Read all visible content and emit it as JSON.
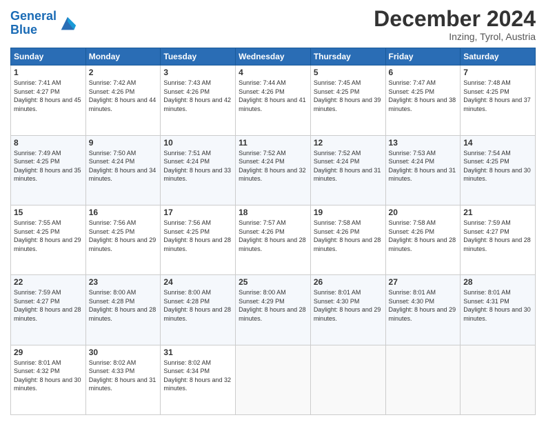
{
  "header": {
    "logo_line1": "General",
    "logo_line2": "Blue",
    "title": "December 2024",
    "subtitle": "Inzing, Tyrol, Austria"
  },
  "weekdays": [
    "Sunday",
    "Monday",
    "Tuesday",
    "Wednesday",
    "Thursday",
    "Friday",
    "Saturday"
  ],
  "weeks": [
    [
      {
        "day": "1",
        "sunrise": "Sunrise: 7:41 AM",
        "sunset": "Sunset: 4:27 PM",
        "daylight": "Daylight: 8 hours and 45 minutes."
      },
      {
        "day": "2",
        "sunrise": "Sunrise: 7:42 AM",
        "sunset": "Sunset: 4:26 PM",
        "daylight": "Daylight: 8 hours and 44 minutes."
      },
      {
        "day": "3",
        "sunrise": "Sunrise: 7:43 AM",
        "sunset": "Sunset: 4:26 PM",
        "daylight": "Daylight: 8 hours and 42 minutes."
      },
      {
        "day": "4",
        "sunrise": "Sunrise: 7:44 AM",
        "sunset": "Sunset: 4:26 PM",
        "daylight": "Daylight: 8 hours and 41 minutes."
      },
      {
        "day": "5",
        "sunrise": "Sunrise: 7:45 AM",
        "sunset": "Sunset: 4:25 PM",
        "daylight": "Daylight: 8 hours and 39 minutes."
      },
      {
        "day": "6",
        "sunrise": "Sunrise: 7:47 AM",
        "sunset": "Sunset: 4:25 PM",
        "daylight": "Daylight: 8 hours and 38 minutes."
      },
      {
        "day": "7",
        "sunrise": "Sunrise: 7:48 AM",
        "sunset": "Sunset: 4:25 PM",
        "daylight": "Daylight: 8 hours and 37 minutes."
      }
    ],
    [
      {
        "day": "8",
        "sunrise": "Sunrise: 7:49 AM",
        "sunset": "Sunset: 4:25 PM",
        "daylight": "Daylight: 8 hours and 35 minutes."
      },
      {
        "day": "9",
        "sunrise": "Sunrise: 7:50 AM",
        "sunset": "Sunset: 4:24 PM",
        "daylight": "Daylight: 8 hours and 34 minutes."
      },
      {
        "day": "10",
        "sunrise": "Sunrise: 7:51 AM",
        "sunset": "Sunset: 4:24 PM",
        "daylight": "Daylight: 8 hours and 33 minutes."
      },
      {
        "day": "11",
        "sunrise": "Sunrise: 7:52 AM",
        "sunset": "Sunset: 4:24 PM",
        "daylight": "Daylight: 8 hours and 32 minutes."
      },
      {
        "day": "12",
        "sunrise": "Sunrise: 7:52 AM",
        "sunset": "Sunset: 4:24 PM",
        "daylight": "Daylight: 8 hours and 31 minutes."
      },
      {
        "day": "13",
        "sunrise": "Sunrise: 7:53 AM",
        "sunset": "Sunset: 4:24 PM",
        "daylight": "Daylight: 8 hours and 31 minutes."
      },
      {
        "day": "14",
        "sunrise": "Sunrise: 7:54 AM",
        "sunset": "Sunset: 4:25 PM",
        "daylight": "Daylight: 8 hours and 30 minutes."
      }
    ],
    [
      {
        "day": "15",
        "sunrise": "Sunrise: 7:55 AM",
        "sunset": "Sunset: 4:25 PM",
        "daylight": "Daylight: 8 hours and 29 minutes."
      },
      {
        "day": "16",
        "sunrise": "Sunrise: 7:56 AM",
        "sunset": "Sunset: 4:25 PM",
        "daylight": "Daylight: 8 hours and 29 minutes."
      },
      {
        "day": "17",
        "sunrise": "Sunrise: 7:56 AM",
        "sunset": "Sunset: 4:25 PM",
        "daylight": "Daylight: 8 hours and 28 minutes."
      },
      {
        "day": "18",
        "sunrise": "Sunrise: 7:57 AM",
        "sunset": "Sunset: 4:26 PM",
        "daylight": "Daylight: 8 hours and 28 minutes."
      },
      {
        "day": "19",
        "sunrise": "Sunrise: 7:58 AM",
        "sunset": "Sunset: 4:26 PM",
        "daylight": "Daylight: 8 hours and 28 minutes."
      },
      {
        "day": "20",
        "sunrise": "Sunrise: 7:58 AM",
        "sunset": "Sunset: 4:26 PM",
        "daylight": "Daylight: 8 hours and 28 minutes."
      },
      {
        "day": "21",
        "sunrise": "Sunrise: 7:59 AM",
        "sunset": "Sunset: 4:27 PM",
        "daylight": "Daylight: 8 hours and 28 minutes."
      }
    ],
    [
      {
        "day": "22",
        "sunrise": "Sunrise: 7:59 AM",
        "sunset": "Sunset: 4:27 PM",
        "daylight": "Daylight: 8 hours and 28 minutes."
      },
      {
        "day": "23",
        "sunrise": "Sunrise: 8:00 AM",
        "sunset": "Sunset: 4:28 PM",
        "daylight": "Daylight: 8 hours and 28 minutes."
      },
      {
        "day": "24",
        "sunrise": "Sunrise: 8:00 AM",
        "sunset": "Sunset: 4:28 PM",
        "daylight": "Daylight: 8 hours and 28 minutes."
      },
      {
        "day": "25",
        "sunrise": "Sunrise: 8:00 AM",
        "sunset": "Sunset: 4:29 PM",
        "daylight": "Daylight: 8 hours and 28 minutes."
      },
      {
        "day": "26",
        "sunrise": "Sunrise: 8:01 AM",
        "sunset": "Sunset: 4:30 PM",
        "daylight": "Daylight: 8 hours and 29 minutes."
      },
      {
        "day": "27",
        "sunrise": "Sunrise: 8:01 AM",
        "sunset": "Sunset: 4:30 PM",
        "daylight": "Daylight: 8 hours and 29 minutes."
      },
      {
        "day": "28",
        "sunrise": "Sunrise: 8:01 AM",
        "sunset": "Sunset: 4:31 PM",
        "daylight": "Daylight: 8 hours and 30 minutes."
      }
    ],
    [
      {
        "day": "29",
        "sunrise": "Sunrise: 8:01 AM",
        "sunset": "Sunset: 4:32 PM",
        "daylight": "Daylight: 8 hours and 30 minutes."
      },
      {
        "day": "30",
        "sunrise": "Sunrise: 8:02 AM",
        "sunset": "Sunset: 4:33 PM",
        "daylight": "Daylight: 8 hours and 31 minutes."
      },
      {
        "day": "31",
        "sunrise": "Sunrise: 8:02 AM",
        "sunset": "Sunset: 4:34 PM",
        "daylight": "Daylight: 8 hours and 32 minutes."
      },
      null,
      null,
      null,
      null
    ]
  ]
}
